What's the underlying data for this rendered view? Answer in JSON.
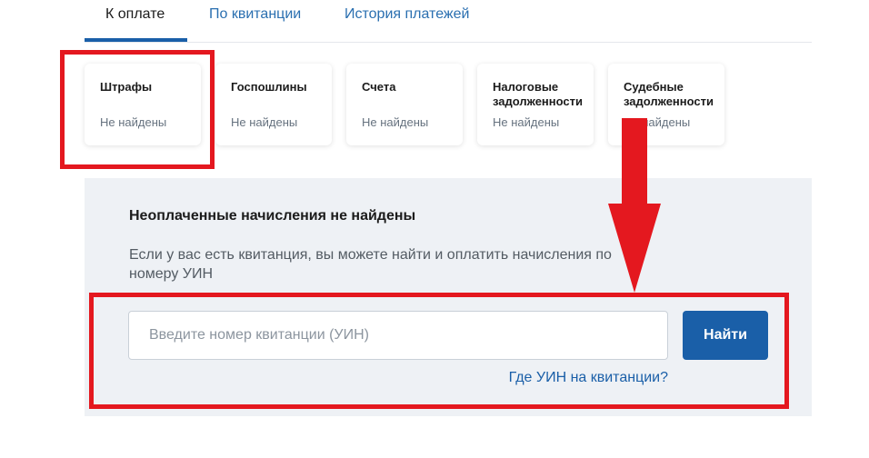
{
  "tabs": [
    {
      "label": "К оплате",
      "active": true
    },
    {
      "label": "По квитанции",
      "active": false
    },
    {
      "label": "История платежей",
      "active": false
    }
  ],
  "categories": [
    {
      "title": "Штрафы",
      "status": "Не найдены"
    },
    {
      "title": "Госпошлины",
      "status": "Не найдены"
    },
    {
      "title": "Счета",
      "status": "Не найдены"
    },
    {
      "title": "Налоговые задолженности",
      "status": "Не найдены"
    },
    {
      "title": "Судебные задолженности",
      "status": "Не найдены"
    }
  ],
  "panel": {
    "title": "Неоплаченные начисления не найдены",
    "description": "Если у вас есть квитанция, вы можете найти и оплатить начисления по номеру УИН",
    "input_value": "",
    "input_placeholder": "Введите номер квитанции (УИН)",
    "button_label": "Найти",
    "help_link": "Где УИН на квитанции?"
  },
  "colors": {
    "accent": "#1a5fa8",
    "annotation": "#e4181f",
    "panel_background": "#eef1f5"
  }
}
